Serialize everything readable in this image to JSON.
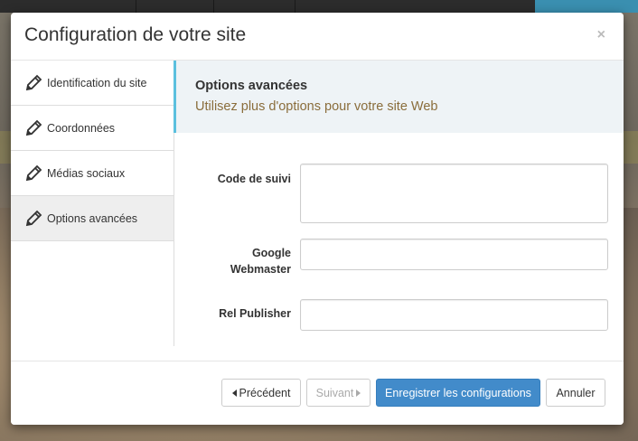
{
  "modal": {
    "title": "Configuration de votre site",
    "close_glyph": "×"
  },
  "sidebar": {
    "items": [
      {
        "label": "Identification du site",
        "icon": "pencil-icon",
        "active": false
      },
      {
        "label": "Coordonnées",
        "icon": "pencil-icon",
        "active": false
      },
      {
        "label": "Médias sociaux",
        "icon": "pencil-icon",
        "active": false
      },
      {
        "label": "Options avancées",
        "icon": "pencil-icon",
        "active": true
      }
    ]
  },
  "section": {
    "heading": "Options avancées",
    "subheading": "Utilisez plus d'options pour votre site Web"
  },
  "form": {
    "tracking_code_label": "Code de suivi",
    "tracking_code_value": "",
    "google_webmaster_label_line1": "Google",
    "google_webmaster_label_line2": "Webmaster",
    "google_webmaster_value": "",
    "rel_publisher_label": "Rel Publisher",
    "rel_publisher_value": ""
  },
  "footer": {
    "previous_label": "Précédent",
    "next_label": "Suivant",
    "save_label": "Enregistrer les configurations",
    "cancel_label": "Annuler"
  },
  "colors": {
    "primary": "#428bca",
    "callout_border": "#5bc0de",
    "subheading": "#8a6d3b"
  }
}
